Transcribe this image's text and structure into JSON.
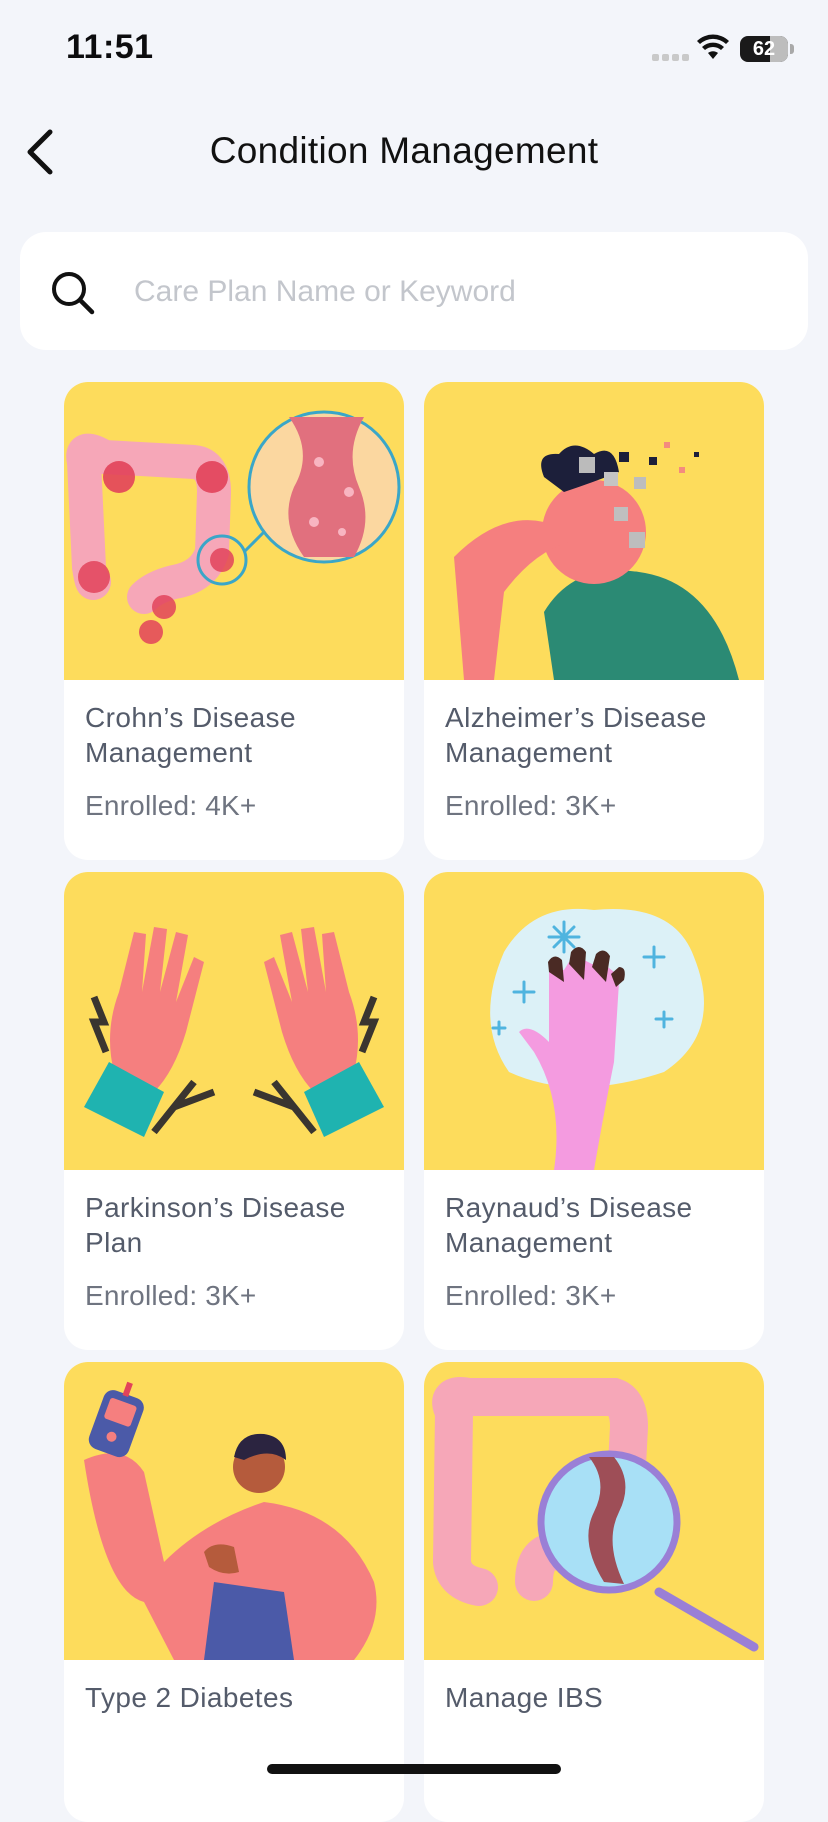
{
  "status_bar": {
    "time": "11:51",
    "battery": "62"
  },
  "header": {
    "title": "Condition Management",
    "back_icon": "chevron-left-icon"
  },
  "search": {
    "placeholder": "Care Plan Name or Keyword",
    "value": "",
    "icon": "search-icon"
  },
  "colors": {
    "card_art_bg": "#fddc5c",
    "page_bg": "#f3f5fa",
    "title_text": "#545b6a"
  },
  "plans": [
    {
      "name": "Crohn’s Disease Management",
      "enrolled": "Enrolled: 4K+",
      "illustration": "intestine-magnified-illustration"
    },
    {
      "name": "Alzheimer’s Disease Management",
      "enrolled": "Enrolled: 3K+",
      "illustration": "head-dissolving-illustration"
    },
    {
      "name": "Parkinson’s Disease Plan",
      "enrolled": "Enrolled: 3K+",
      "illustration": "trembling-hands-illustration"
    },
    {
      "name": "Raynaud’s Disease Management",
      "enrolled": "Enrolled: 3K+",
      "illustration": "cold-hand-illustration"
    },
    {
      "name": "Type 2 Diabetes",
      "enrolled": "",
      "illustration": "glucose-meter-person-illustration"
    },
    {
      "name": "Manage IBS",
      "enrolled": "",
      "illustration": "colon-magnifier-illustration"
    }
  ]
}
